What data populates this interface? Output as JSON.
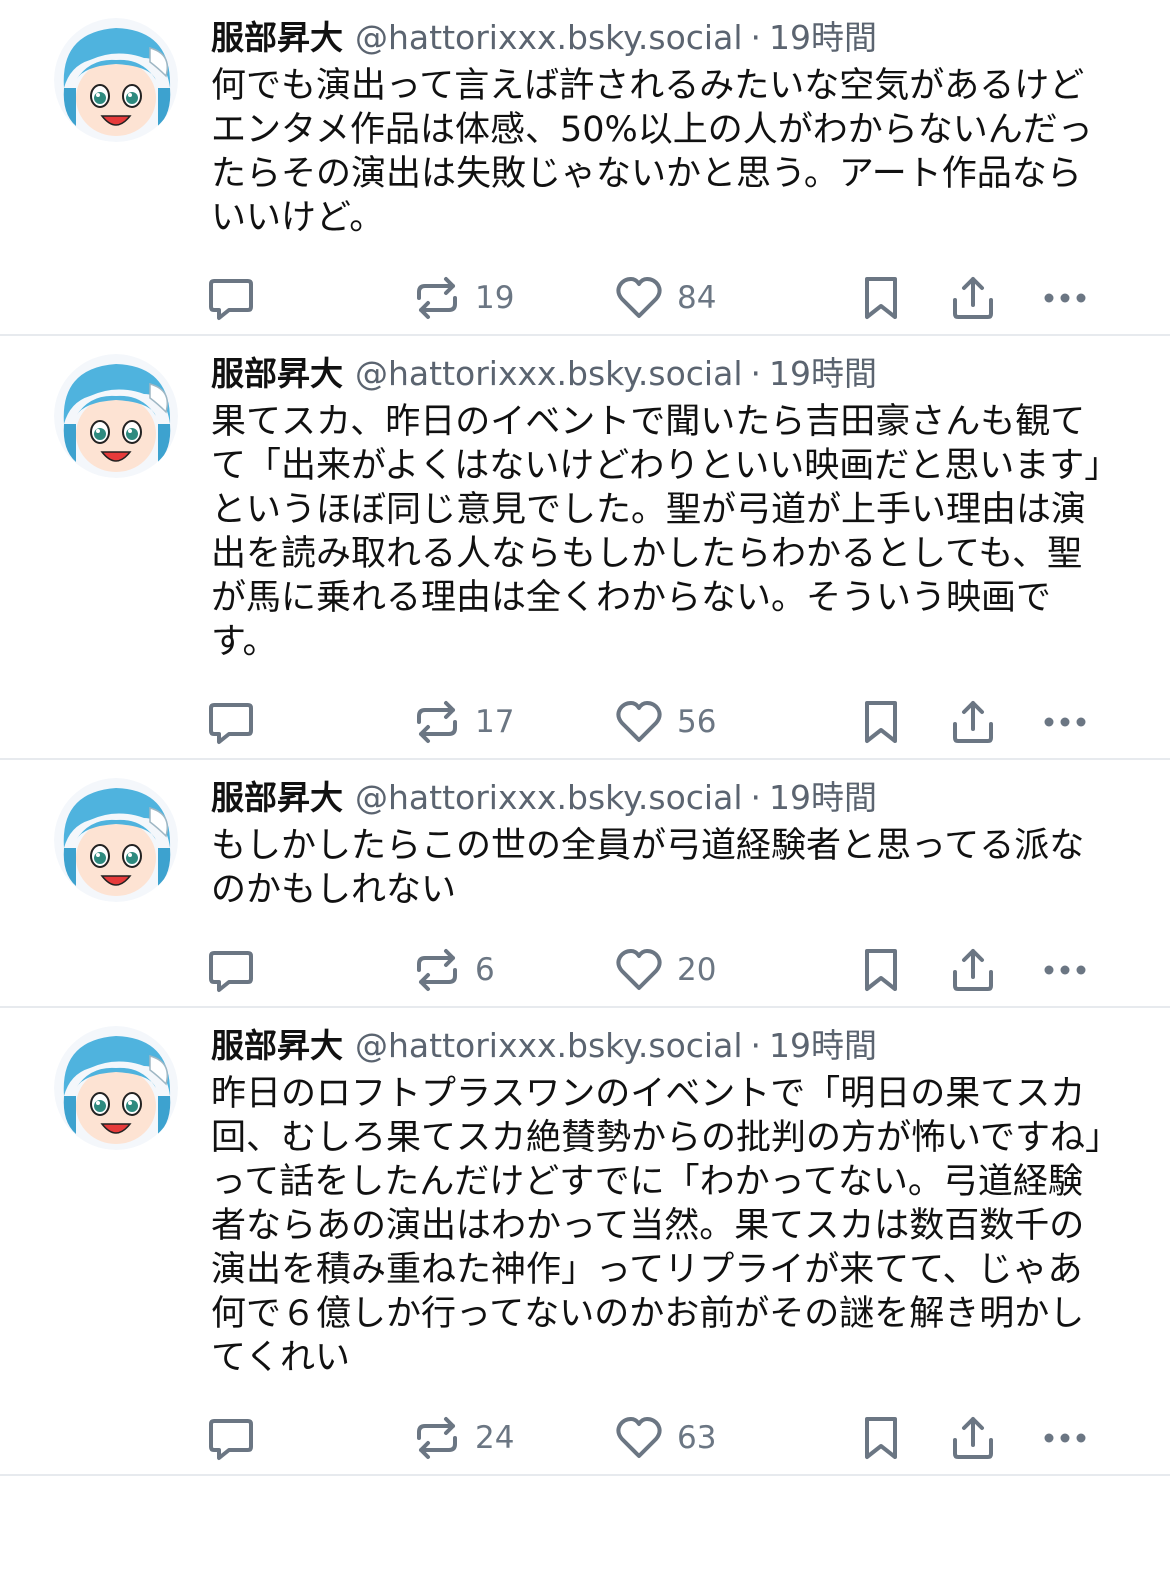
{
  "colors": {
    "icon": "#6b7683",
    "meta": "#5b6470",
    "divider": "#e7eaee",
    "avatar_hair": "#4fb3de"
  },
  "icons": {
    "reply": "speech-bubble-icon",
    "repost": "repost-icon",
    "like": "heart-icon",
    "save": "bookmark-icon",
    "share": "share-icon",
    "more": "ellipsis-icon"
  },
  "posts": [
    {
      "author": "服部昇大",
      "handle": "@hattorixxx.bsky.social",
      "separator": "·",
      "time": "19時間",
      "text": "何でも演出って言えば許されるみたいな空気があるけどエンタメ作品は体感、50%以上の人がわからないんだったらその演出は失敗じゃないかと思う。アート作品ならいいけど。",
      "reposts": "19",
      "likes": "84"
    },
    {
      "author": "服部昇大",
      "handle": "@hattorixxx.bsky.social",
      "separator": "·",
      "time": "19時間",
      "text": "果てスカ、昨日のイベントで聞いたら吉田豪さんも観てて「出来がよくはないけどわりといい映画だと思います」というほぼ同じ意見でした。聖が弓道が上手い理由は演出を読み取れる人ならもしかしたらわかるとしても、聖が馬に乗れる理由は全くわからない。そういう映画です。",
      "reposts": "17",
      "likes": "56"
    },
    {
      "author": "服部昇大",
      "handle": "@hattorixxx.bsky.social",
      "separator": "·",
      "time": "19時間",
      "text": "もしかしたらこの世の全員が弓道経験者と思ってる派なのかもしれない",
      "reposts": "6",
      "likes": "20"
    },
    {
      "author": "服部昇大",
      "handle": "@hattorixxx.bsky.social",
      "separator": "·",
      "time": "19時間",
      "text": "昨日のロフトプラスワンのイベントで「明日の果てスカ回、むしろ果てスカ絶賛勢からの批判の方が怖いですね」って話をしたんだけどすでに「わかってない。弓道経験者ならあの演出はわかって当然。果てスカは数百数千の演出を積み重ねた神作」ってリプライが来てて、じゃあ何で６億しか行ってないのかお前がその謎を解き明かしてくれい",
      "reposts": "24",
      "likes": "63"
    }
  ]
}
